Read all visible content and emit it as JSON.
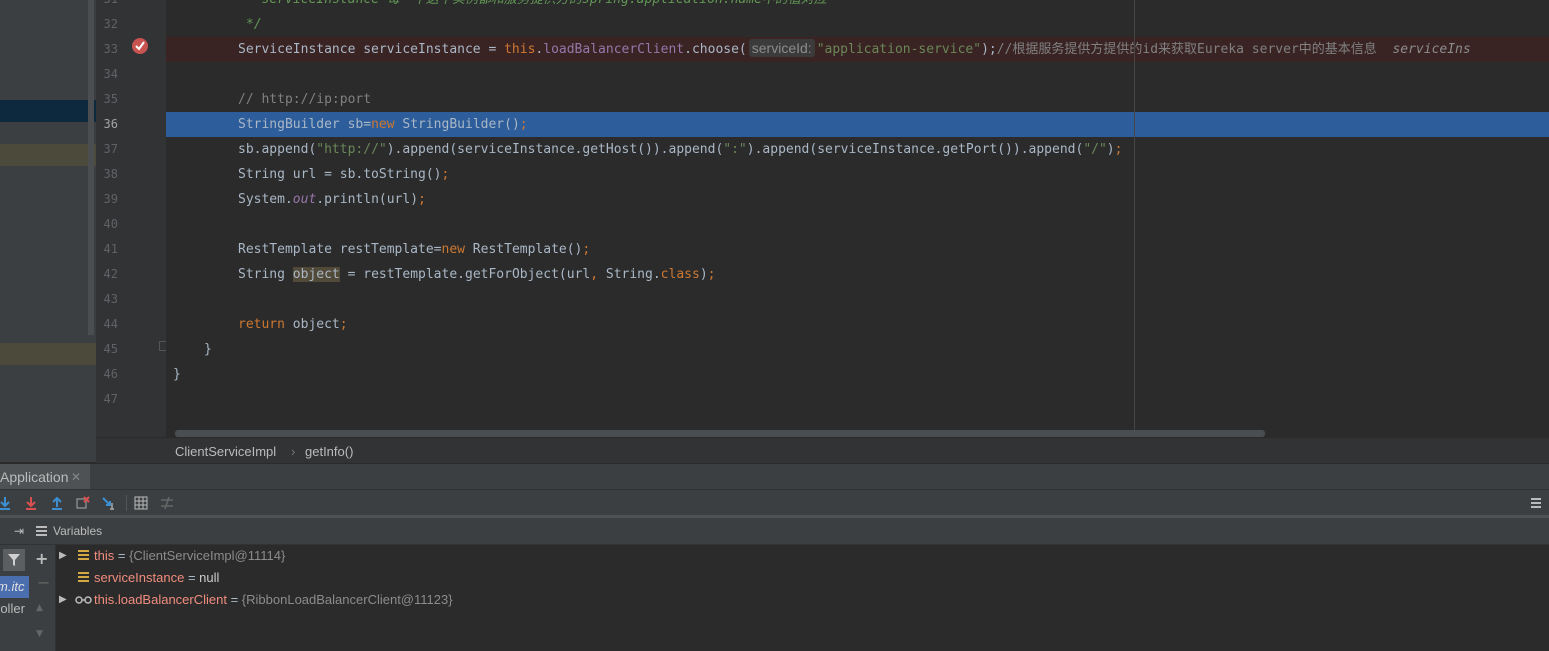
{
  "gutter": {
    "line_numbers": [
      "31",
      "32",
      "33",
      "34",
      "35",
      "36",
      "37",
      "38",
      "39",
      "40",
      "41",
      "42",
      "43",
      "44",
      "45",
      "46",
      "47"
    ]
  },
  "editor": {
    "line31_doc": "* serviceInstance 每一个这个实例都和服务提供方的spring.application.name中的值对应",
    "line32_doc": "*/",
    "line33": {
      "a": "ServiceInstance serviceInstance = ",
      "this": "this",
      "dot": ".",
      "field": "loadBalancerClient",
      "b": ".choose(",
      "hint": "serviceId:",
      "str": "\"application-service\"",
      "c": ");",
      "comment": "//根据服务提供方提供的id来获取Eureka server中的基本信息",
      "inline": "serviceIns"
    },
    "line35_comment": "// http://ip:port",
    "line36": {
      "a": "StringBuilder sb=",
      "new": "new",
      "b": " StringBuilder()",
      "semi": ";"
    },
    "line37": {
      "a": "sb.append(",
      "s1": "\"http://\"",
      "b": ").append(serviceInstance.getHost()).append(",
      "s2": "\":\"",
      "c": ").append(serviceInstance.getPort()).append(",
      "s3": "\"/\"",
      "d": ")",
      "semi": ";"
    },
    "line38": {
      "a": "String url = sb.toString()",
      "semi": ";"
    },
    "line39": {
      "a": "System.",
      "out": "out",
      "b": ".println(url)",
      "semi": ";"
    },
    "line41": {
      "a": "RestTemplate restTemplate=",
      "new": "new",
      "b": " RestTemplate()",
      "semi": ";"
    },
    "line42": {
      "a": "String ",
      "obj": "object",
      "b": " = restTemplate.getForObject(url",
      "comma": ",",
      "c": " String.",
      "cls": "class",
      "d": ")",
      "semi": ";"
    },
    "line44": {
      "ret": "return",
      "a": " object",
      "semi": ";"
    },
    "line45": "}",
    "line46": "}"
  },
  "breadcrumb": {
    "class": "ClientServiceImpl",
    "method": "getInfo()"
  },
  "debug": {
    "tab_label": "Application",
    "vars_label": "Variables",
    "frames": [
      {
        "label": "m.itc"
      },
      {
        "label": "roller"
      }
    ],
    "variables": [
      {
        "name": "this",
        "eq": " = ",
        "value": "{ClientServiceImpl@11114}"
      },
      {
        "name": "serviceInstance",
        "eq": " = ",
        "value": "null"
      },
      {
        "name": "this.loadBalancerClient",
        "eq": " = ",
        "value": "{RibbonLoadBalancerClient@11123}"
      }
    ]
  },
  "colors": {
    "background": "#2b2b2b",
    "current_line": "#2d5d9a",
    "breakpoint_line": "#3a2323",
    "breakpoint": "#c75450",
    "keyword": "#cc7832",
    "string": "#6a8759",
    "variable_name": "#f08d7e"
  }
}
